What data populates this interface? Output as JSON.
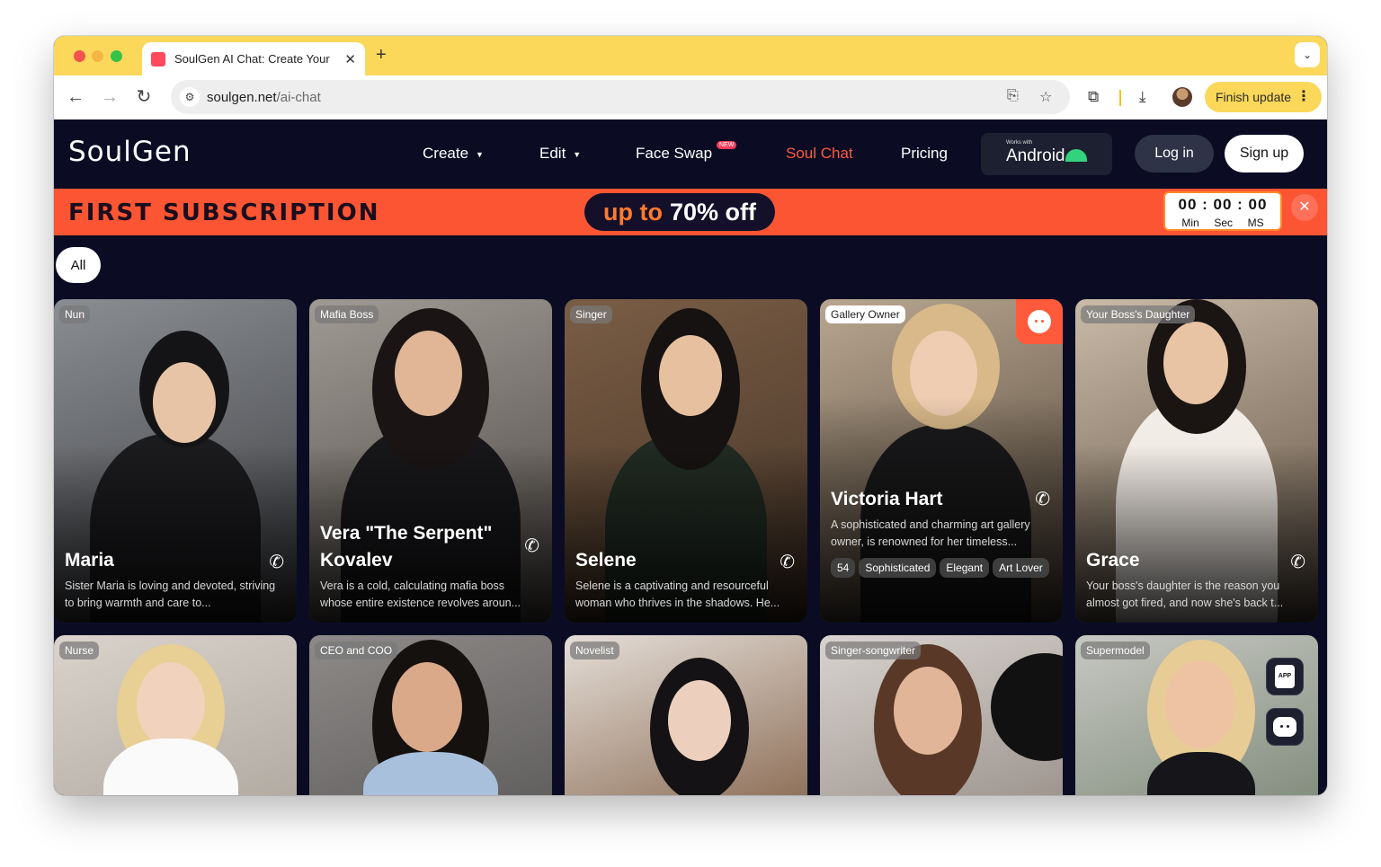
{
  "browser": {
    "tab_title": "SoulGen AI Chat: Create Your",
    "url_host": "soulgen.net",
    "url_path": "/ai-chat",
    "finish_update": "Finish update"
  },
  "site": {
    "logo": "SoulGen",
    "nav": {
      "create": "Create",
      "edit": "Edit",
      "face_swap": "Face Swap",
      "face_swap_badge": "NEW",
      "soul_chat": "Soul Chat",
      "pricing": "Pricing"
    },
    "android": {
      "small": "Works with",
      "label": "Android"
    },
    "login": "Log in",
    "signup": "Sign up",
    "accent_color": "#ff5a3c"
  },
  "promo": {
    "headline": "FIRST SUBSCRIPTION",
    "upto": "up to",
    "offer": "70% off",
    "timer": {
      "digits": "00 : 00 : 00",
      "min": "Min",
      "sec": "Sec",
      "ms": "MS"
    }
  },
  "filter": {
    "all": "All"
  },
  "cards_row1": [
    {
      "tag": "Nun",
      "name": "Maria",
      "desc": "Sister Maria is loving and devoted, striving to bring warmth and care to..."
    },
    {
      "tag": "Mafia Boss",
      "name": "Vera \"The Serpent\" Kovalev",
      "desc": "Vera is a cold, calculating mafia boss whose entire existence revolves aroun..."
    },
    {
      "tag": "Singer",
      "name": "Selene",
      "desc": "Selene is a captivating and resourceful woman who thrives in the shadows. He..."
    },
    {
      "tag": "Gallery Owner",
      "name": "Victoria Hart",
      "desc": "A sophisticated and charming art gallery owner, is renowned for her timeless...",
      "chips": [
        "54",
        "Sophisticated",
        "Elegant",
        "Art Lover"
      ]
    },
    {
      "tag": "Your Boss's Daughter",
      "name": "Grace",
      "desc": "Your boss's daughter is the reason you almost got fired, and now she's back t..."
    }
  ],
  "cards_row2": [
    {
      "tag": "Nurse"
    },
    {
      "tag": "CEO and COO"
    },
    {
      "tag": "Novelist"
    },
    {
      "tag": "Singer-songwriter"
    },
    {
      "tag": "Supermodel"
    }
  ],
  "floating": {
    "app_label": "APP"
  }
}
